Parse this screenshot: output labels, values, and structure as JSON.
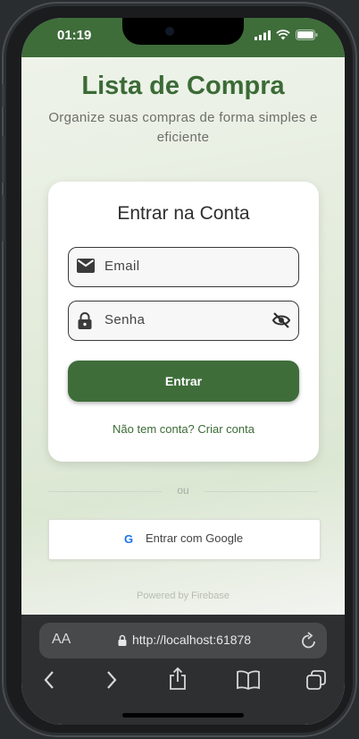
{
  "status_bar": {
    "time": "01:19"
  },
  "app": {
    "title": "Lista de Compra",
    "subtitle": "Organize suas compras de forma simples e eficiente"
  },
  "login_card": {
    "title": "Entrar na Conta",
    "email_placeholder": "Email",
    "password_placeholder": "Senha",
    "submit_label": "Entrar",
    "signup_link": "Não tem conta? Criar conta"
  },
  "divider_text": "ou",
  "google": {
    "icon_letter": "G",
    "label": "Entrar com Google"
  },
  "powered_by": "Powered by Firebase",
  "browser": {
    "text_size_label": "AA",
    "url": "http://localhost:61878"
  },
  "colors": {
    "brand_green": "#3e6d3a",
    "title_green": "#3b6b36",
    "google_blue": "#1a73e8"
  }
}
